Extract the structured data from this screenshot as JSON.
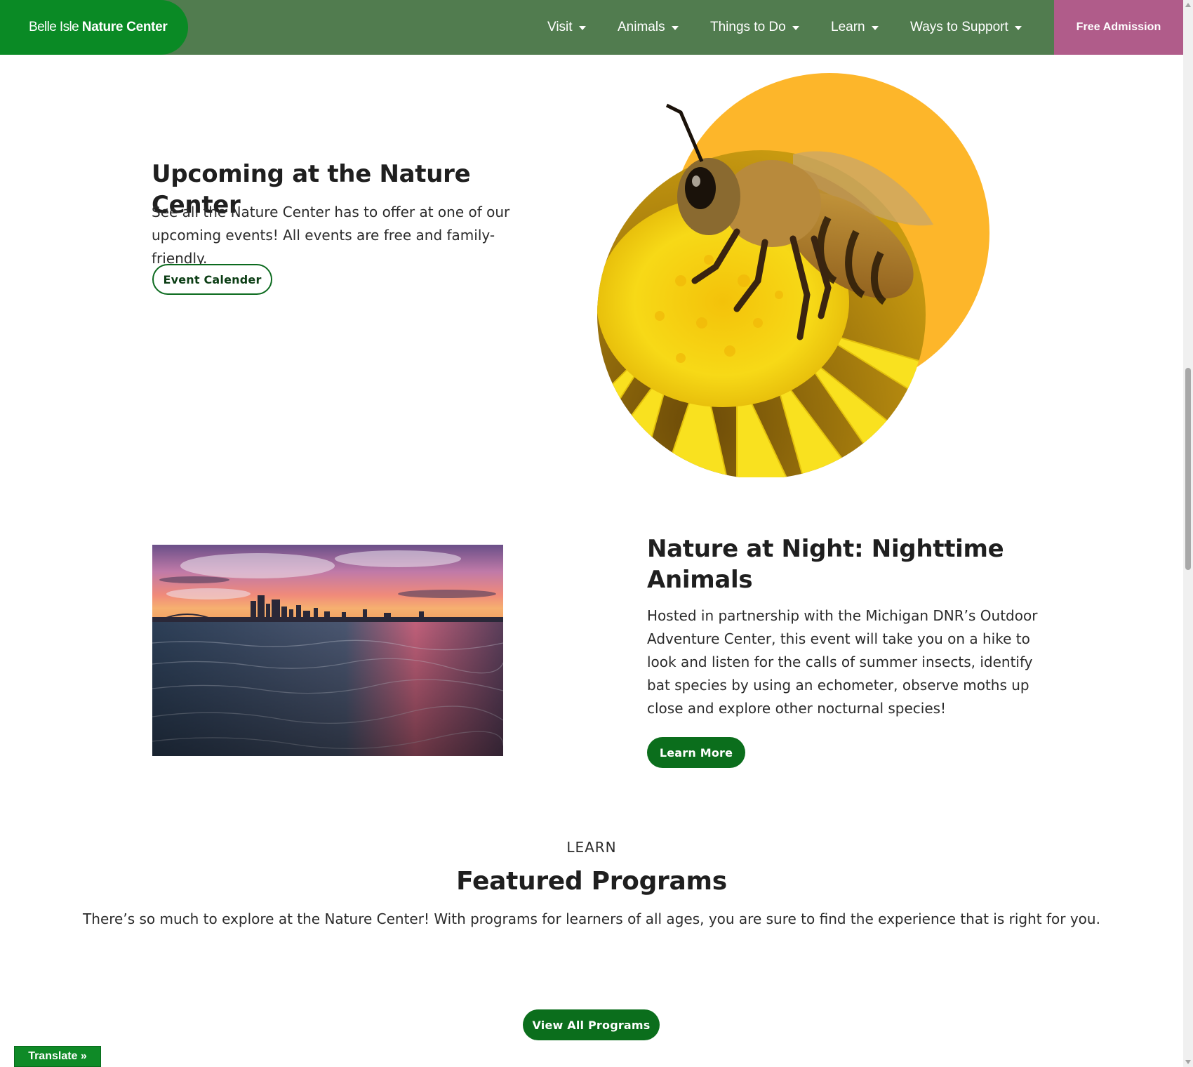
{
  "header": {
    "logo_light": "Belle Isle ",
    "logo_bold": "Nature Center",
    "nav": [
      {
        "label": "Visit"
      },
      {
        "label": "Animals"
      },
      {
        "label": "Things to Do"
      },
      {
        "label": "Learn"
      },
      {
        "label": "Ways to Support"
      }
    ],
    "cta_label": "Free Admission"
  },
  "upcoming": {
    "title": "Upcoming at the Nature Center",
    "text": "See all the Nature Center has to offer at one of our upcoming events! All events are free and family-friendly.",
    "button_label": "Event Calender"
  },
  "night": {
    "title": "Nature at Night: Nighttime Animals",
    "text": "Hosted in partnership with the Michigan DNR’s Outdoor Adventure Center, this event will take you on a hike to look and listen for the calls of summer insects, identify bat species by using an echometer, observe moths up close and explore other nocturnal species!",
    "button_label": "Learn More"
  },
  "featured": {
    "eyebrow": "LEARN",
    "title": "Featured Programs",
    "text": "There’s so much to explore at the Nature Center! With programs for learners of all ages, you are sure to find the experience that is right for you.",
    "button_label": "View All Programs"
  },
  "translate_label": "Translate »",
  "colors": {
    "header_bg": "#517c4f",
    "logo_bg": "#0a8a25",
    "cta_bg": "#b05c8a",
    "button_green": "#0b6e1c",
    "accent_orange": "#fdb62a",
    "accent_yellow": "#f6d21a"
  }
}
